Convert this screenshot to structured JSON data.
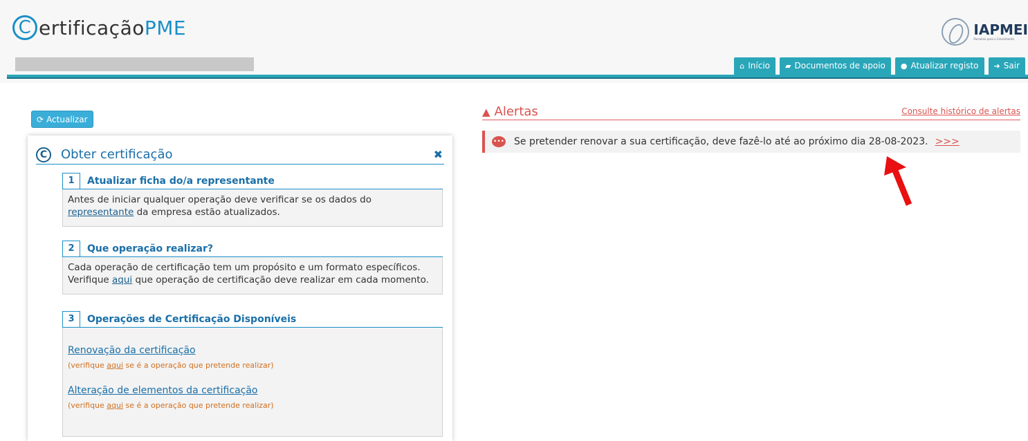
{
  "header": {
    "logo_prefix": "C",
    "logo_main": "ertificação",
    "logo_suffix": "PME",
    "partner_logo": "IAPMEI",
    "partner_tagline": "Parceiros para o Crescimento",
    "nav": [
      {
        "icon": "home-icon",
        "label": "Início"
      },
      {
        "icon": "book-icon",
        "label": "Documentos de apoio"
      },
      {
        "icon": "user-icon",
        "label": "Atualizar registo"
      },
      {
        "icon": "sign-out-icon",
        "label": "Sair"
      }
    ]
  },
  "refresh_button": {
    "label": "Actualizar"
  },
  "panel": {
    "title": "Obter certificação",
    "steps": [
      {
        "number": "1",
        "title": "Atualizar ficha do/a representante",
        "text_before": "Antes de iniciar qualquer operação deve verificar se os dados do",
        "link": "representante",
        "text_after": " da empresa estão atualizados."
      },
      {
        "number": "2",
        "title": "Que operação realizar?",
        "line1": "Cada operação de certificação tem um propósito e um formato específicos.",
        "line2_before": "Verifique ",
        "link": "aqui",
        "line2_after": " que operação de certificação deve realizar em cada momento."
      },
      {
        "number": "3",
        "title": "Operações de Certificação Disponíveis",
        "operations": [
          {
            "label": "Renovação da certificação",
            "note_before": "(verifique ",
            "note_link": "aqui",
            "note_after": " se é a operação que pretende realizar)"
          },
          {
            "label": "Alteração de elementos da certificação",
            "note_before": "(verifique ",
            "note_link": "aqui",
            "note_after": " se é a operação que pretende realizar)"
          }
        ]
      }
    ]
  },
  "alerts": {
    "title": "Alertas",
    "history_link": "Consulte histórico de alertas",
    "message": "Se pretender renovar a sua certificação, deve fazê-lo até ao próximo dia 28-08-2023.",
    "more_link": ">>>",
    "accent_color": "#d9534f"
  }
}
